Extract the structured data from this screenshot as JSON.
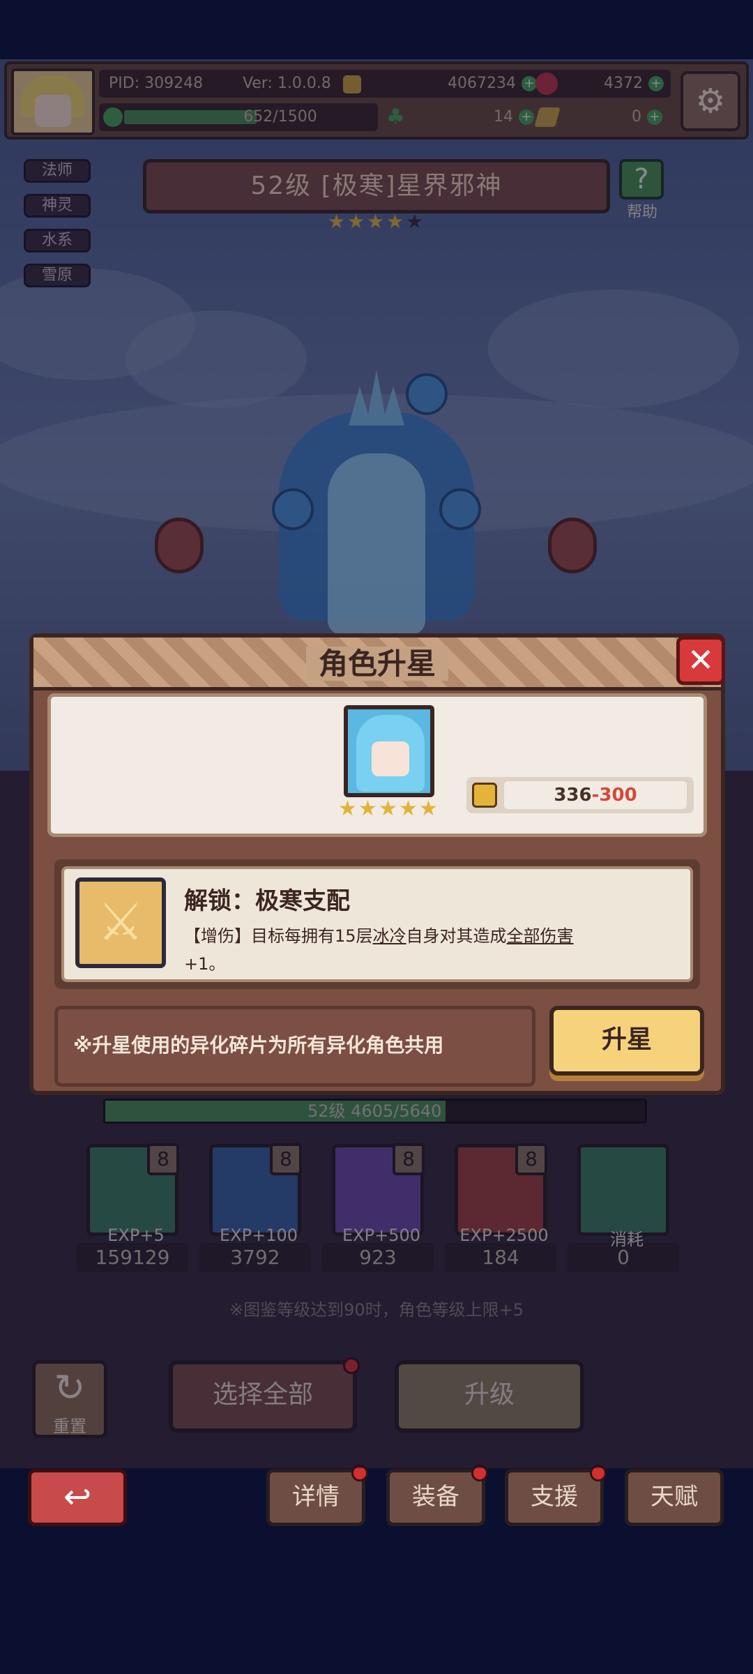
{
  "header": {
    "pid": "PID: 309248",
    "version": "Ver: 1.0.0.8",
    "gold": "4067234",
    "gems": "4372",
    "stamina": "652/1500",
    "clover": "14",
    "tickets": "0",
    "plus": "+"
  },
  "tags": [
    "法师",
    "神灵",
    "水系",
    "雪原"
  ],
  "character": {
    "title": "52级 [极寒]星界邪神",
    "stars_filled": 4,
    "stars_total": 5,
    "help_label": "帮助"
  },
  "modal": {
    "title": "角色升星",
    "close_icon": "✕",
    "shard_have": "336",
    "shard_sep": "-",
    "shard_need": "300",
    "unlock_title": "解锁：极寒支配",
    "unlock_desc_1": "【增伤】目标每拥有15层",
    "unlock_desc_link1": "冰冷",
    "unlock_desc_2": "自身对其造成",
    "unlock_desc_link2": "全部伤害",
    "unlock_desc_3": "+1。",
    "note": "※升星使用的异化碎片为所有异化角色共用",
    "upstar_button": "升星"
  },
  "level_bar": {
    "text": "52级 4605/5640",
    "progress": 0.63
  },
  "items": [
    {
      "label": "EXP+5",
      "count": "159129",
      "color": "#3f7a5a"
    },
    {
      "label": "EXP+100",
      "count": "3792",
      "color": "#3a5f9c"
    },
    {
      "label": "EXP+500",
      "count": "923",
      "color": "#6a4aa0"
    },
    {
      "label": "EXP+2500",
      "count": "184",
      "color": "#9e3f3a"
    },
    {
      "label": "消耗",
      "count": "0",
      "color": "#3f7a5a"
    }
  ],
  "hint": "※图鉴等级达到90时，角色等级上限+5",
  "buttons": {
    "reset": "重置",
    "select_all": "选择全部",
    "upgrade": "升级"
  },
  "nav": {
    "details": "详情",
    "equipment": "装备",
    "support": "支援",
    "talent": "天赋"
  },
  "icons": {
    "star": "★",
    "gear": "⚙",
    "help": "?",
    "back": "↩",
    "sword": "⚔",
    "lock": "8",
    "reset": "↻"
  }
}
